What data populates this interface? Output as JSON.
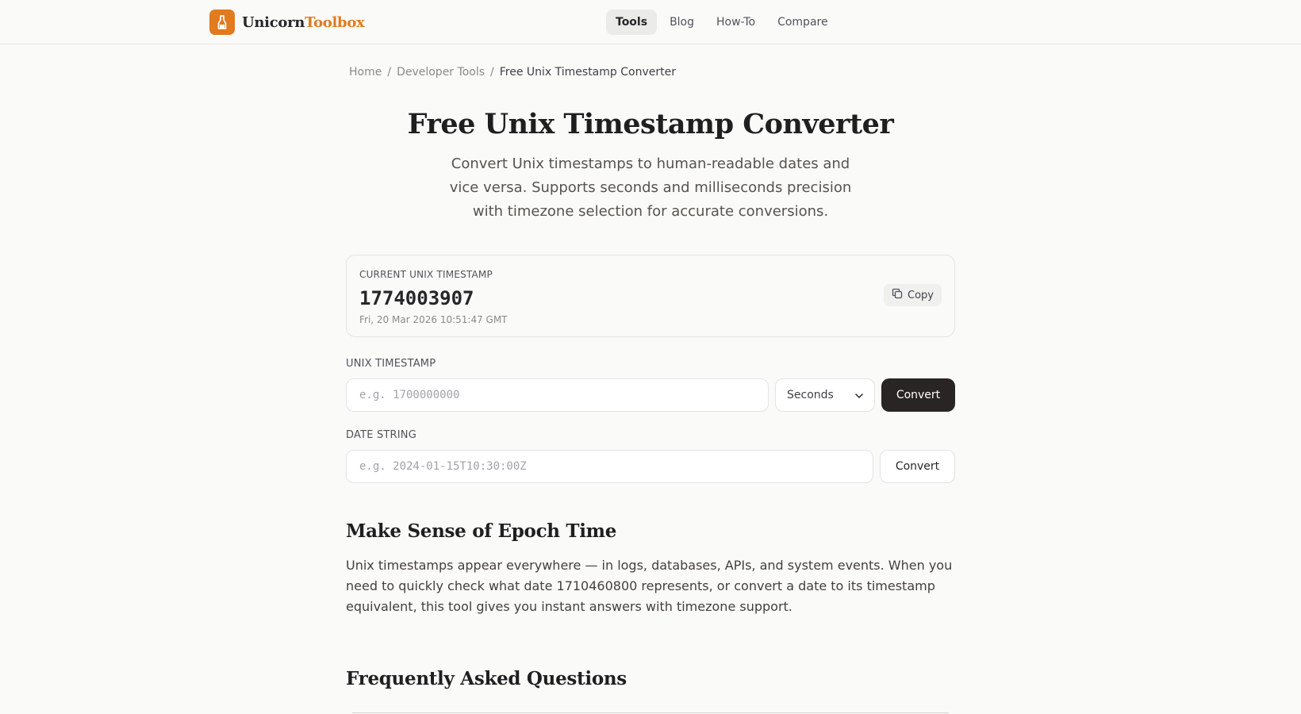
{
  "header": {
    "logo_name": "Unicorn",
    "logo_accent": "Toolbox",
    "nav": [
      {
        "label": "Tools",
        "active": true
      },
      {
        "label": "Blog",
        "active": false
      },
      {
        "label": "How-To",
        "active": false
      },
      {
        "label": "Compare",
        "active": false
      }
    ]
  },
  "breadcrumb": {
    "items": [
      "Home",
      "Developer Tools"
    ],
    "current": "Free Unix Timestamp Converter",
    "separator": "/"
  },
  "page": {
    "title": "Free Unix Timestamp Converter",
    "subtitle": "Convert Unix timestamps to human-readable dates and vice versa. Supports seconds and milliseconds precision with timezone selection for accurate conversions."
  },
  "current_timestamp": {
    "label": "CURRENT UNIX TIMESTAMP",
    "value": "1774003907",
    "date": "Fri, 20 Mar 2026 10:51:47 GMT",
    "copy_label": "Copy"
  },
  "unix_input": {
    "label": "UNIX TIMESTAMP",
    "placeholder": "e.g. 1700000000",
    "value": "",
    "unit_selected": "Seconds",
    "convert_label": "Convert"
  },
  "date_input": {
    "label": "DATE STRING",
    "placeholder": "e.g. 2024-01-15T10:30:00Z",
    "value": "",
    "convert_label": "Convert"
  },
  "content": {
    "heading": "Make Sense of Epoch Time",
    "paragraph": "Unix timestamps appear everywhere — in logs, databases, APIs, and system events. When you need to quickly check what date 1710460800 represents, or convert a date to its timestamp equivalent, this tool gives you instant answers with timezone support.",
    "faq_heading": "Frequently Asked Questions"
  },
  "colors": {
    "accent": "#e07b1f",
    "dark_button": "#292524",
    "background": "#fafaf9"
  },
  "icons": {
    "logo": "bottle-icon",
    "copy": "copy-icon",
    "select": "chevron-down-icon"
  }
}
